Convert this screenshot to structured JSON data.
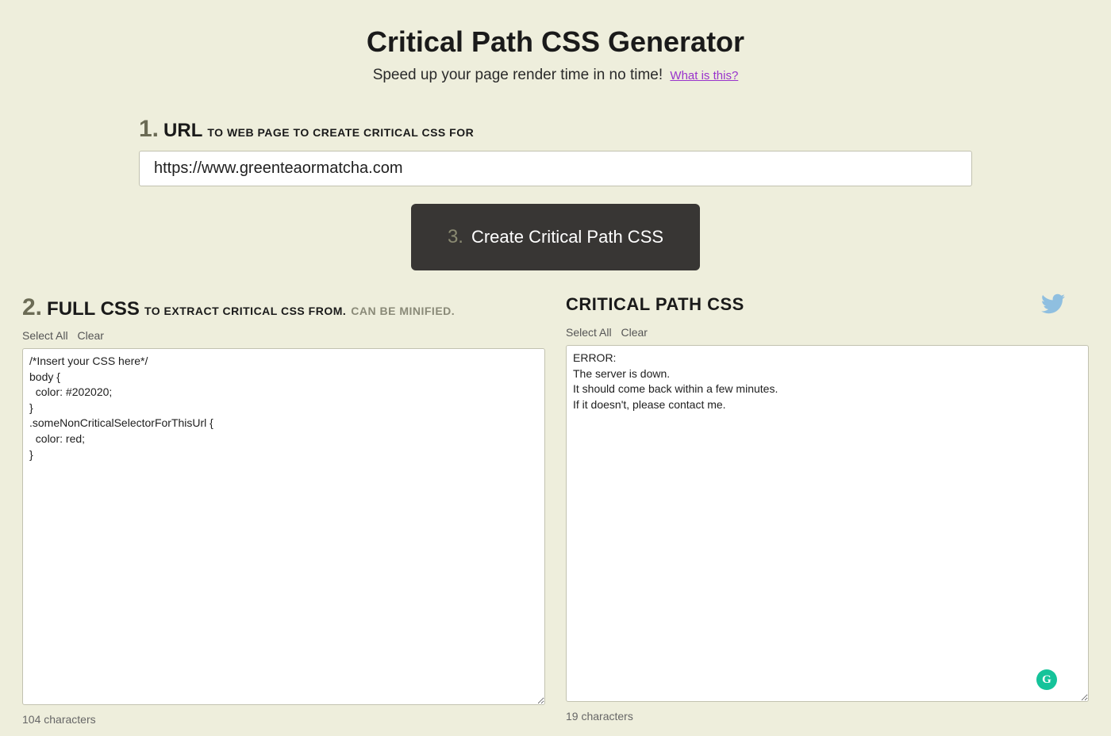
{
  "header": {
    "title": "Critical Path CSS Generator",
    "subtitle": "Speed up your page render time in no time!",
    "what_link": "What is this?"
  },
  "url_section": {
    "step_num": "1.",
    "step_main": "URL",
    "step_sub": "TO WEB PAGE TO CREATE CRITICAL CSS FOR",
    "value": "https://www.greenteaormatcha.com"
  },
  "cta": {
    "step_num": "3.",
    "label": "Create Critical Path CSS"
  },
  "left": {
    "step_num": "2.",
    "step_main": "FULL CSS",
    "step_sub": "TO EXTRACT CRITICAL CSS FROM.",
    "step_sub_muted": "CAN BE MINIFIED.",
    "select_all": "Select All",
    "clear": "Clear",
    "textarea_value": "/*Insert your CSS here*/\nbody {\n  color: #202020;\n}\n.someNonCriticalSelectorForThisUrl {\n  color: red;\n}",
    "char_count": "104 characters"
  },
  "right": {
    "title": "CRITICAL PATH CSS",
    "select_all": "Select All",
    "clear": "Clear",
    "textarea_value": "ERROR:\nThe server is down.\nIt should come back within a few minutes.\nIf it doesn't, please contact me.",
    "char_count": "19 characters"
  },
  "badges": {
    "grammarly_letter": "G"
  }
}
